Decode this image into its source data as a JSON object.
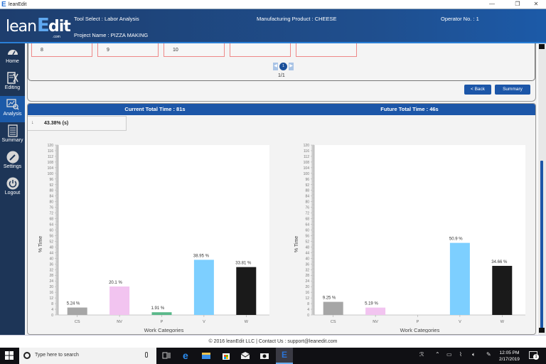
{
  "window": {
    "title": "leanEdit",
    "controls": {
      "minimize": "—",
      "restore": "❐",
      "close": "✕"
    }
  },
  "header": {
    "logo": {
      "lean": "lean",
      "e": "E",
      "dit": "dit",
      "com": ".com"
    },
    "tool_select": "Tool Select : Labor Analysis",
    "project_name": "Project Name : PIZZA MAKING",
    "manufacturing_product": "Manufacturing Product : CHEESE",
    "operator": "Operator No. : 1"
  },
  "sidebar": {
    "items": [
      {
        "label": "Home",
        "icon": "dashboard-icon",
        "active": false
      },
      {
        "label": "Editing",
        "icon": "edit-scissors-icon",
        "active": false
      },
      {
        "label": "Analysis",
        "icon": "analysis-chart-icon",
        "active": true
      },
      {
        "label": "Summary",
        "icon": "document-icon",
        "active": false
      },
      {
        "label": "Settings",
        "icon": "wrench-icon",
        "active": false
      },
      {
        "label": "Logout",
        "icon": "power-icon",
        "active": false
      }
    ]
  },
  "steps": {
    "boxes": [
      "8",
      "9",
      "10",
      "",
      ""
    ],
    "pager": {
      "prev": "◀",
      "current": "1",
      "next": "▶",
      "info": "1/1"
    }
  },
  "buttons": {
    "back": "< Back",
    "summary": "Summary"
  },
  "analysis": {
    "current_title": "Current Total Time : 81s",
    "future_title": "Future Total Time : 46s",
    "reduction_arrow": "↓",
    "reduction_value": "43.38% (s)"
  },
  "chart_data": [
    {
      "type": "bar",
      "title": "Current Total Time : 81s",
      "xlabel": "Work Categories",
      "ylabel": "% Time",
      "ylim": [
        0,
        120
      ],
      "ytick_step": 4,
      "categories": [
        "CS",
        "NV",
        "P",
        "V",
        "W"
      ],
      "values": [
        5.24,
        20.1,
        1.91,
        38.95,
        33.81
      ],
      "labels": [
        "5.24 %",
        "20.1 %",
        "1.91 %",
        "38.95 %",
        "33.81 %"
      ],
      "colors": [
        "#a6a6a6",
        "#f2c4f0",
        "#5ab88a",
        "#7dcfff",
        "#1a1a1a"
      ]
    },
    {
      "type": "bar",
      "title": "Future Total Time : 46s",
      "xlabel": "Work Categories",
      "ylabel": "% Time",
      "ylim": [
        0,
        120
      ],
      "ytick_step": 4,
      "categories": [
        "CS",
        "NV",
        "P",
        "V",
        "W"
      ],
      "values": [
        9.25,
        5.19,
        0,
        50.9,
        34.66
      ],
      "labels": [
        "9.25 %",
        "5.19 %",
        "",
        "50.9 %",
        "34.66 %"
      ],
      "colors": [
        "#a6a6a6",
        "#f2c4f0",
        "#5ab88a",
        "#7dcfff",
        "#1a1a1a"
      ]
    }
  ],
  "footer": {
    "text": "© 2016 leanEdit LLC | Contact Us : support@leanedit.com"
  },
  "taskbar": {
    "search_placeholder": "Type here to search",
    "time": "12:05 PM",
    "date": "2/17/2019",
    "notification_count": "1"
  }
}
